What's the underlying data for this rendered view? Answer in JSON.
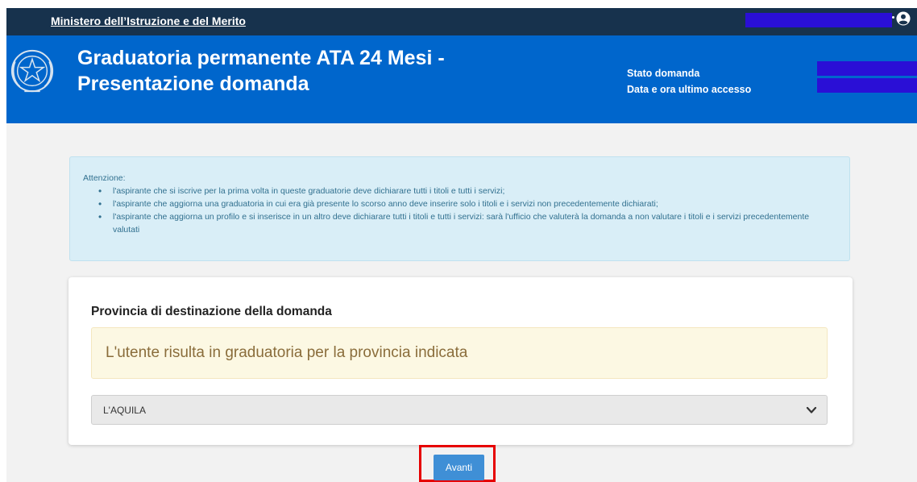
{
  "topbar": {
    "ministry_link": "Ministero dell’Istruzione e del Merito",
    "user_icon": "user-circle-icon"
  },
  "header": {
    "emblem_icon": "italian-republic-emblem-icon",
    "title_line1": "Graduatoria permanente ATA 24 Mesi -",
    "title_line2": "Presentazione domanda",
    "status_label": "Stato domanda",
    "last_access_label": "Data e ora ultimo accesso"
  },
  "alert": {
    "title": "Attenzione:",
    "items": [
      "l'aspirante che si iscrive per la prima volta in queste graduatorie deve dichiarare tutti i titoli e tutti i servizi;",
      "l'aspirante che aggiorna una graduatoria in cui era già presente lo scorso anno deve inserire solo i titoli e i servizi non precedentemente dichiarati;",
      "l'aspirante che aggiorna un profilo e si inserisce in un altro deve dichiarare tutti i titoli e tutti i servizi: sarà l'ufficio che valuterà la domanda a non valutare i titoli e i servizi precedentemente valutati"
    ]
  },
  "form": {
    "province_label": "Provincia di destinazione della domanda",
    "warning_text": "L'utente risulta in graduatoria per la provincia indicata",
    "province_selected": "L'AQUILA",
    "chevron_icon": "chevron-down-icon"
  },
  "actions": {
    "next_label": "Avanti"
  },
  "colors": {
    "topbar_bg": "#17324d",
    "header_bg": "#0066cc",
    "redaction": "#2a0fd6",
    "alert_bg": "#d9eef7",
    "alert_text": "#31708f",
    "warning_bg": "#fcf8e3",
    "warning_text": "#8a6d3b",
    "button_bg": "#3f8fd6",
    "highlight": "#e60000"
  }
}
